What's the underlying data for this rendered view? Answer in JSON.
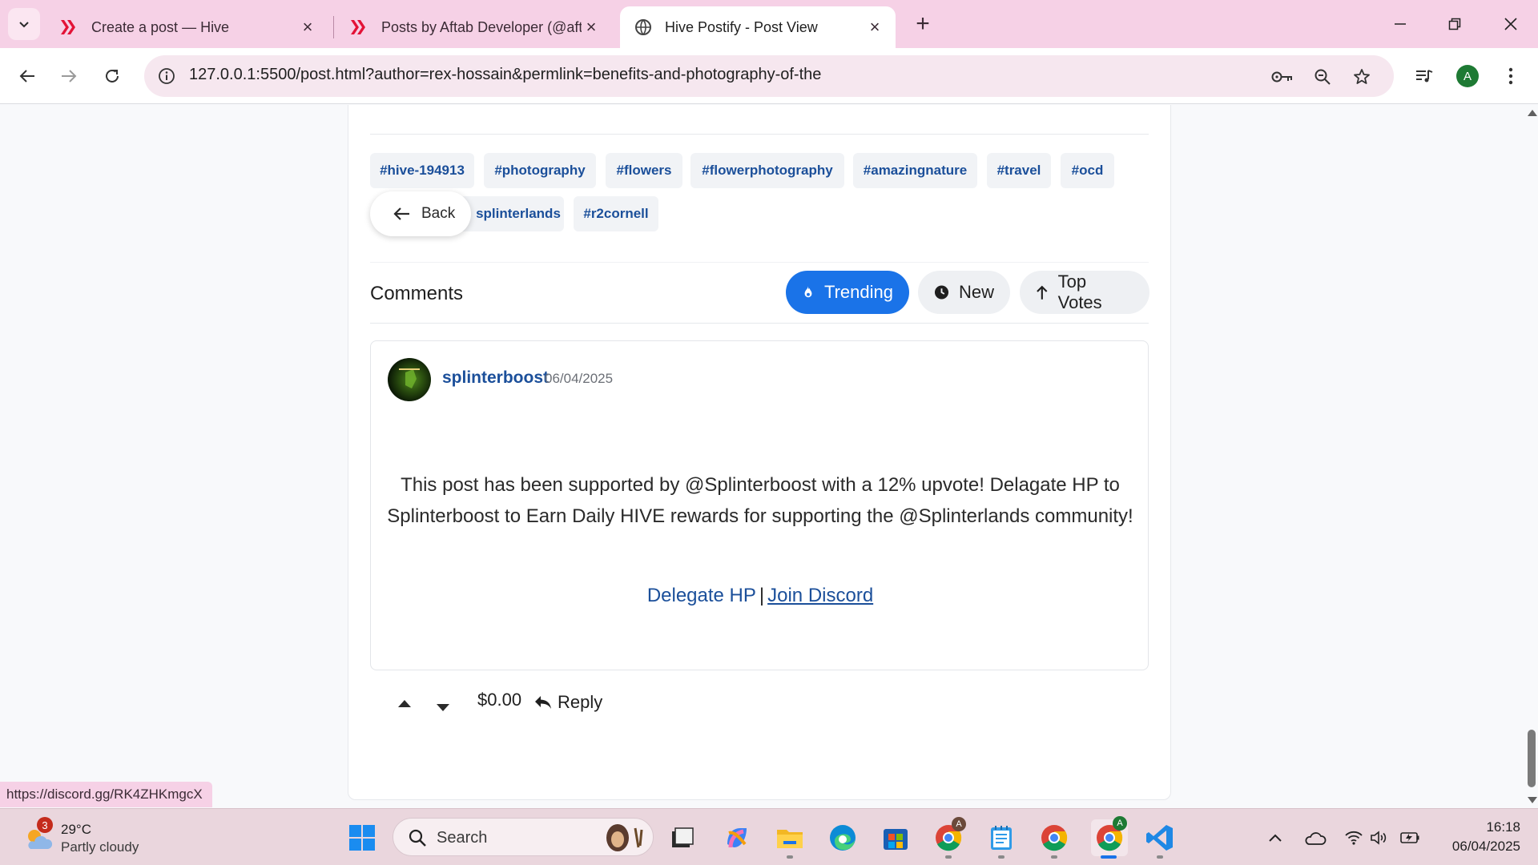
{
  "browser": {
    "tabs": [
      {
        "label": "Create a post — Hive",
        "favicon": "hive-logo-icon"
      },
      {
        "label": "Posts by Aftab Developer (@aft",
        "favicon": "hive-logo-icon"
      },
      {
        "label": "Hive Postify - Post View",
        "favicon": "globe-icon"
      }
    ],
    "url": "127.0.0.1:5500/post.html?author=rex-hossain&permlink=benefits-and-photography-of-the",
    "profile_initial": "A",
    "status_url": "https://discord.gg/RK4ZHKmgcX"
  },
  "post": {
    "tags": [
      "#hive-194913",
      "#photography",
      "#flowers",
      "#flowerphotography",
      "#amazingnature",
      "#travel",
      "#ocd",
      "splinterlands",
      "#r2cornell"
    ],
    "back_label": "Back"
  },
  "comments": {
    "title": "Comments",
    "sort": {
      "trending": "Trending",
      "new": "New",
      "top": "Top Votes"
    },
    "items": [
      {
        "author": "splinterboost",
        "date": "06/04/2025",
        "body": "This post has been supported by @Splinterboost with a 12% upvote! Delagate HP to Splinterboost to Earn Daily HIVE rewards for supporting the @Splinterlands community!",
        "link_delegate": "Delegate HP",
        "link_sep": "|",
        "link_discord": "Join Discord",
        "payout": "$0.00",
        "reply_label": "Reply"
      }
    ]
  },
  "taskbar": {
    "weather_temp": "29°C",
    "weather_cond": "Partly cloudy",
    "weather_badge": "3",
    "search_label": "Search",
    "time": "16:18",
    "date": "06/04/2025",
    "chrome_badge_1": "A",
    "chrome_badge_2": "A"
  },
  "colors": {
    "accent": "#1a73e8",
    "link": "#1b4f9a",
    "tabstrip": "#f6d1e6"
  }
}
